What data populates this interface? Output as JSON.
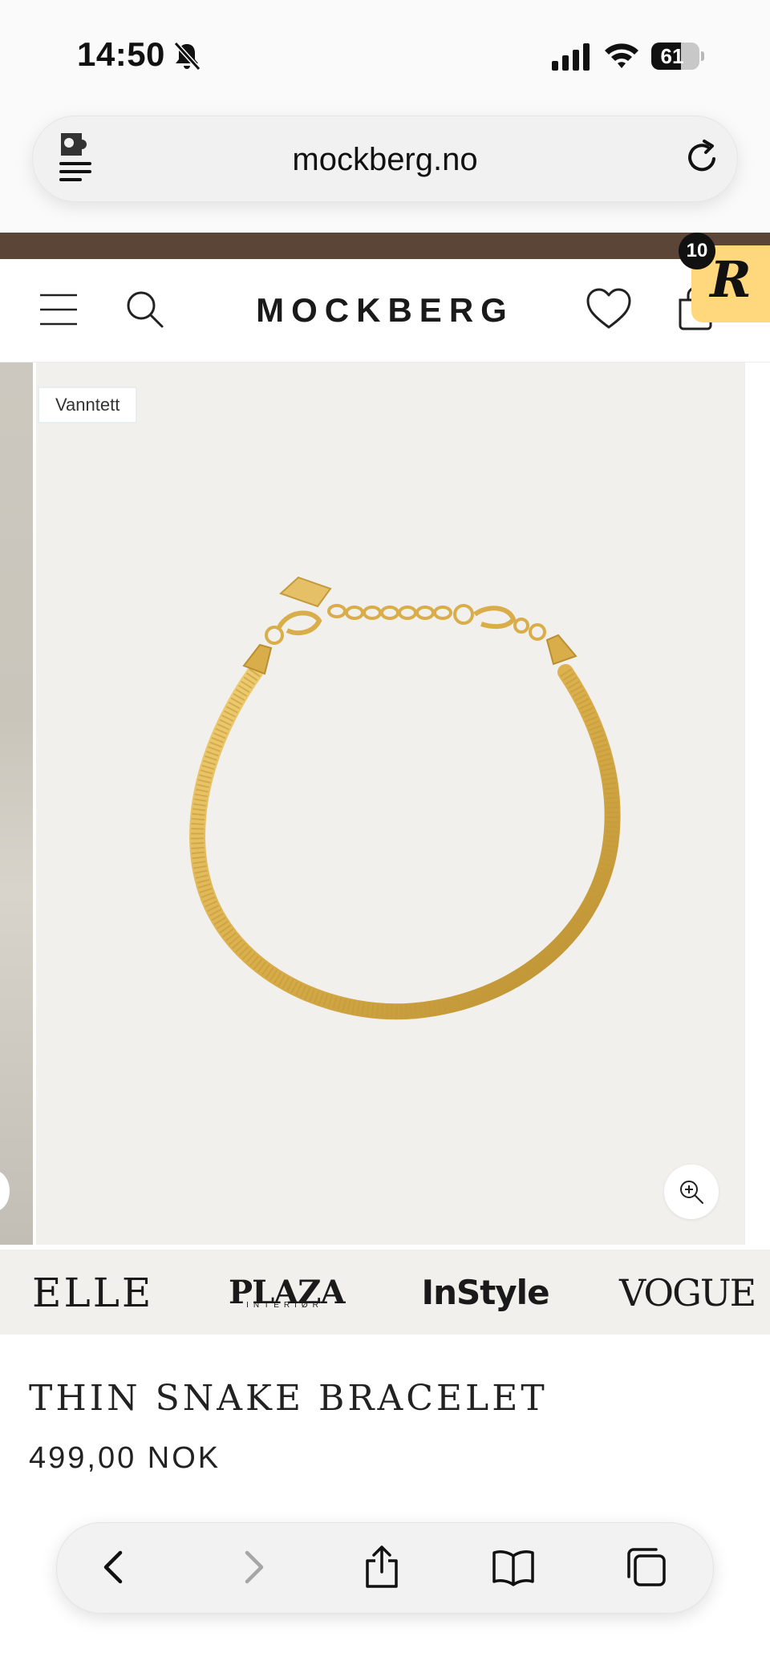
{
  "status_bar": {
    "time": "14:50",
    "battery_percent": "61",
    "battery_level": 0.61,
    "icons": [
      "bell-slash-icon",
      "cellular-signal-icon",
      "wifi-icon",
      "battery-icon"
    ]
  },
  "browser": {
    "url": "mockberg.no",
    "icons": [
      "extension-icon",
      "reload-icon"
    ]
  },
  "header": {
    "logo": "MOCKBERG",
    "rewards_count": "10",
    "rewards_letter": "R",
    "icons": [
      "menu-icon",
      "search-icon",
      "heart-icon",
      "shopping-bag-icon"
    ]
  },
  "gallery": {
    "badge": "Vanntett",
    "icons": [
      "zoom-in-icon"
    ]
  },
  "press": {
    "logos": [
      "ELLE",
      "PLAZA",
      "InStyle",
      "VOGUE"
    ],
    "plaza_sub": "INTERIØR"
  },
  "product": {
    "title": "THIN SNAKE BRACELET",
    "price": "499,00 NOK"
  },
  "toolbar": {
    "icons": [
      "back-icon",
      "forward-icon",
      "share-icon",
      "bookmarks-icon",
      "tabs-icon"
    ]
  },
  "colors": {
    "promo_strip": "#5a4536",
    "rewards_badge": "#ffd87e",
    "gallery_bg": "#f2f0ec",
    "gold": "#d9ae4a"
  }
}
